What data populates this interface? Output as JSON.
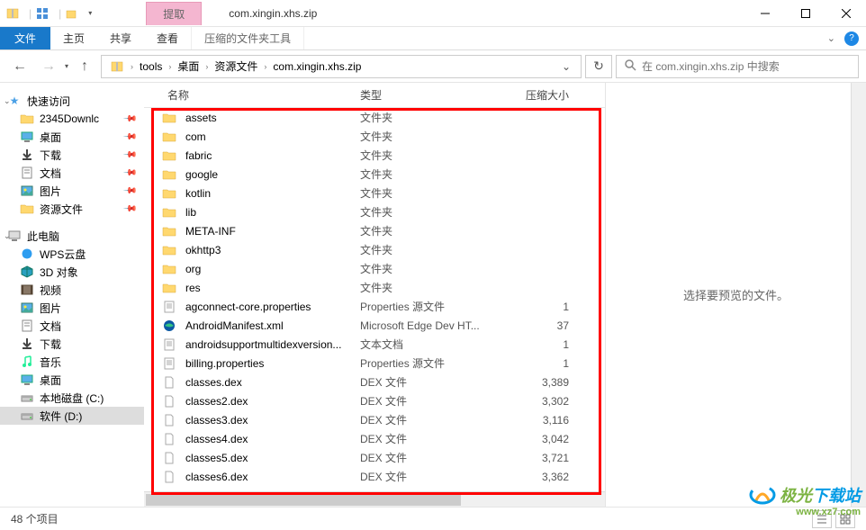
{
  "titlebar": {
    "context_tab": "提取",
    "title": "com.xingin.xhs.zip"
  },
  "ribbon": {
    "file": "文件",
    "tabs": [
      "主页",
      "共享",
      "查看"
    ],
    "context_tab": "压缩的文件夹工具"
  },
  "nav": {
    "crumbs": [
      "tools",
      "桌面",
      "资源文件",
      "com.xingin.xhs.zip"
    ]
  },
  "search": {
    "placeholder": "在 com.xingin.xhs.zip 中搜索"
  },
  "sidebar": {
    "quick_access": "快速访问",
    "quick_items": [
      {
        "label": "2345Downlc",
        "icon": "folder",
        "color": "#ffd86f"
      },
      {
        "label": "桌面",
        "icon": "desktop",
        "color": "#3b8fd6"
      },
      {
        "label": "下载",
        "icon": "download",
        "color": "#444"
      },
      {
        "label": "文档",
        "icon": "doc",
        "color": "#444"
      },
      {
        "label": "图片",
        "icon": "image",
        "color": "#3b8fd6"
      },
      {
        "label": "资源文件",
        "icon": "folder",
        "color": "#ffd86f"
      }
    ],
    "this_pc": "此电脑",
    "pc_items": [
      {
        "label": "WPS云盘",
        "icon": "wps",
        "color": "#2e9df0"
      },
      {
        "label": "3D 对象",
        "icon": "3d",
        "color": "#2aa0c0"
      },
      {
        "label": "视频",
        "icon": "video",
        "color": "#876"
      },
      {
        "label": "图片",
        "icon": "image",
        "color": "#3b8fd6"
      },
      {
        "label": "文档",
        "icon": "doc",
        "color": "#444"
      },
      {
        "label": "下载",
        "icon": "download",
        "color": "#444"
      },
      {
        "label": "音乐",
        "icon": "music",
        "color": "#2e9"
      },
      {
        "label": "桌面",
        "icon": "desktop",
        "color": "#3b8fd6"
      },
      {
        "label": "本地磁盘 (C:)",
        "icon": "disk",
        "color": "#888"
      },
      {
        "label": "软件 (D:)",
        "icon": "disk",
        "color": "#888"
      }
    ]
  },
  "columns": {
    "name": "名称",
    "type": "类型",
    "size": "压缩大小"
  },
  "files": [
    {
      "name": "assets",
      "type": "文件夹",
      "size": "",
      "icon": "folder"
    },
    {
      "name": "com",
      "type": "文件夹",
      "size": "",
      "icon": "folder"
    },
    {
      "name": "fabric",
      "type": "文件夹",
      "size": "",
      "icon": "folder"
    },
    {
      "name": "google",
      "type": "文件夹",
      "size": "",
      "icon": "folder"
    },
    {
      "name": "kotlin",
      "type": "文件夹",
      "size": "",
      "icon": "folder"
    },
    {
      "name": "lib",
      "type": "文件夹",
      "size": "",
      "icon": "folder"
    },
    {
      "name": "META-INF",
      "type": "文件夹",
      "size": "",
      "icon": "folder"
    },
    {
      "name": "okhttp3",
      "type": "文件夹",
      "size": "",
      "icon": "folder"
    },
    {
      "name": "org",
      "type": "文件夹",
      "size": "",
      "icon": "folder"
    },
    {
      "name": "res",
      "type": "文件夹",
      "size": "",
      "icon": "folder"
    },
    {
      "name": "agconnect-core.properties",
      "type": "Properties 源文件",
      "size": "1",
      "icon": "text"
    },
    {
      "name": "AndroidManifest.xml",
      "type": "Microsoft Edge Dev HT...",
      "size": "37",
      "icon": "edge"
    },
    {
      "name": "androidsupportmultidexversion...",
      "type": "文本文档",
      "size": "1",
      "icon": "text"
    },
    {
      "name": "billing.properties",
      "type": "Properties 源文件",
      "size": "1",
      "icon": "text"
    },
    {
      "name": "classes.dex",
      "type": "DEX 文件",
      "size": "3,389",
      "icon": "file"
    },
    {
      "name": "classes2.dex",
      "type": "DEX 文件",
      "size": "3,302",
      "icon": "file"
    },
    {
      "name": "classes3.dex",
      "type": "DEX 文件",
      "size": "3,116",
      "icon": "file"
    },
    {
      "name": "classes4.dex",
      "type": "DEX 文件",
      "size": "3,042",
      "icon": "file"
    },
    {
      "name": "classes5.dex",
      "type": "DEX 文件",
      "size": "3,721",
      "icon": "file"
    },
    {
      "name": "classes6.dex",
      "type": "DEX 文件",
      "size": "3,362",
      "icon": "file"
    }
  ],
  "preview": {
    "empty_text": "选择要预览的文件。"
  },
  "status": {
    "count": "48 个项目"
  },
  "watermark": {
    "line1a": "极光",
    "line1b": "下载站",
    "line2": "www.xz7.com"
  }
}
